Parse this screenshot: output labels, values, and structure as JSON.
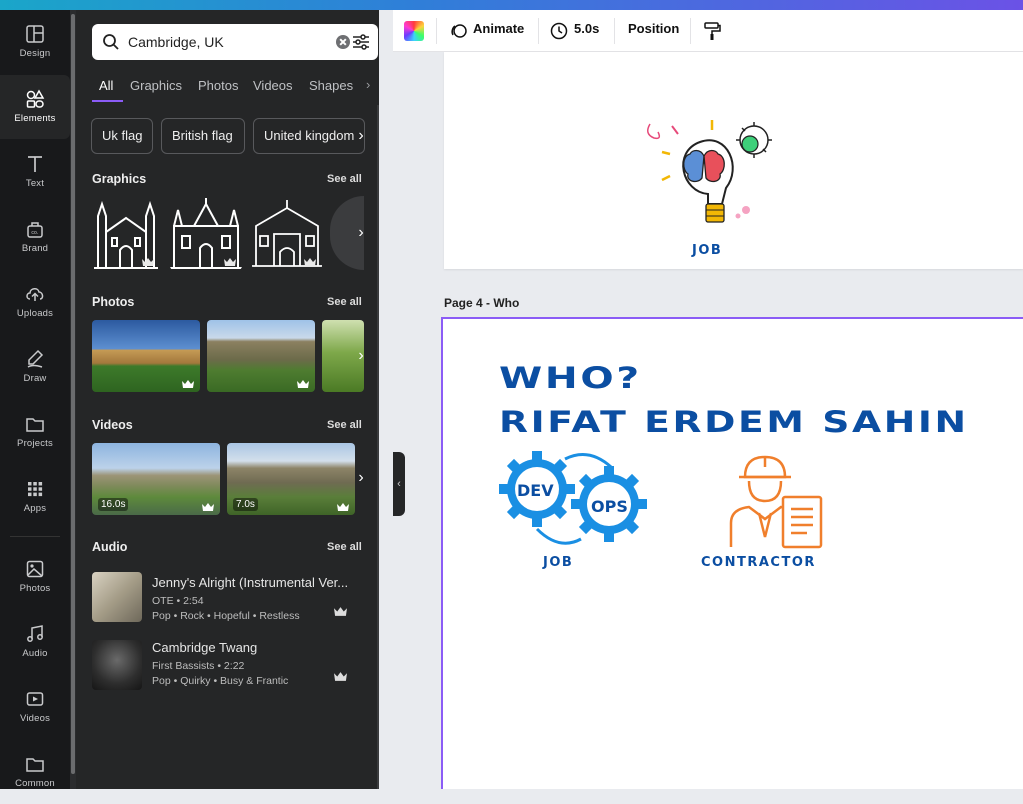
{
  "rail": {
    "items": [
      {
        "label": "Design"
      },
      {
        "label": "Elements"
      },
      {
        "label": "Text"
      },
      {
        "label": "Brand"
      },
      {
        "label": "Uploads"
      },
      {
        "label": "Draw"
      },
      {
        "label": "Projects"
      },
      {
        "label": "Apps"
      },
      {
        "label": "Photos"
      },
      {
        "label": "Audio"
      },
      {
        "label": "Videos"
      },
      {
        "label": "Common"
      }
    ]
  },
  "search": {
    "value": "Cambridge, UK"
  },
  "tabs": [
    "All",
    "Graphics",
    "Photos",
    "Videos",
    "Shapes"
  ],
  "chips": [
    "Uk flag",
    "British flag",
    "United kingdom"
  ],
  "sections": {
    "graphics": {
      "title": "Graphics",
      "see_all": "See all"
    },
    "photos": {
      "title": "Photos",
      "see_all": "See all"
    },
    "videos": {
      "title": "Videos",
      "see_all": "See all",
      "durations": [
        "16.0s",
        "7.0s"
      ]
    },
    "audio": {
      "title": "Audio",
      "see_all": "See all"
    }
  },
  "audio": [
    {
      "title": "Jenny's Alright (Instrumental Ver...",
      "artist": "OTE • 2:54",
      "tags": "Pop • Rock • Hopeful • Restless"
    },
    {
      "title": "Cambridge Twang",
      "artist": "First Bassists • 2:22",
      "tags": "Pop • Quirky • Busy & Frantic"
    }
  ],
  "toolbar": {
    "animate": "Animate",
    "duration": "5.0s",
    "position": "Position"
  },
  "canvas": {
    "page3_caption": "JOB",
    "page4_label": "Page 4 - Who",
    "who": "WHO?",
    "name": "RIFAT ERDEM  SAHIN",
    "gear_left": "DEV",
    "gear_right": "OPS",
    "job_caption": "JOB",
    "contractor_caption": "CONTRACTOR"
  },
  "colors": {
    "accent": "#8b5cf6",
    "brand_blue": "#0b4ea2",
    "gear_blue": "#1a8fe3",
    "orange": "#f07f2c"
  }
}
